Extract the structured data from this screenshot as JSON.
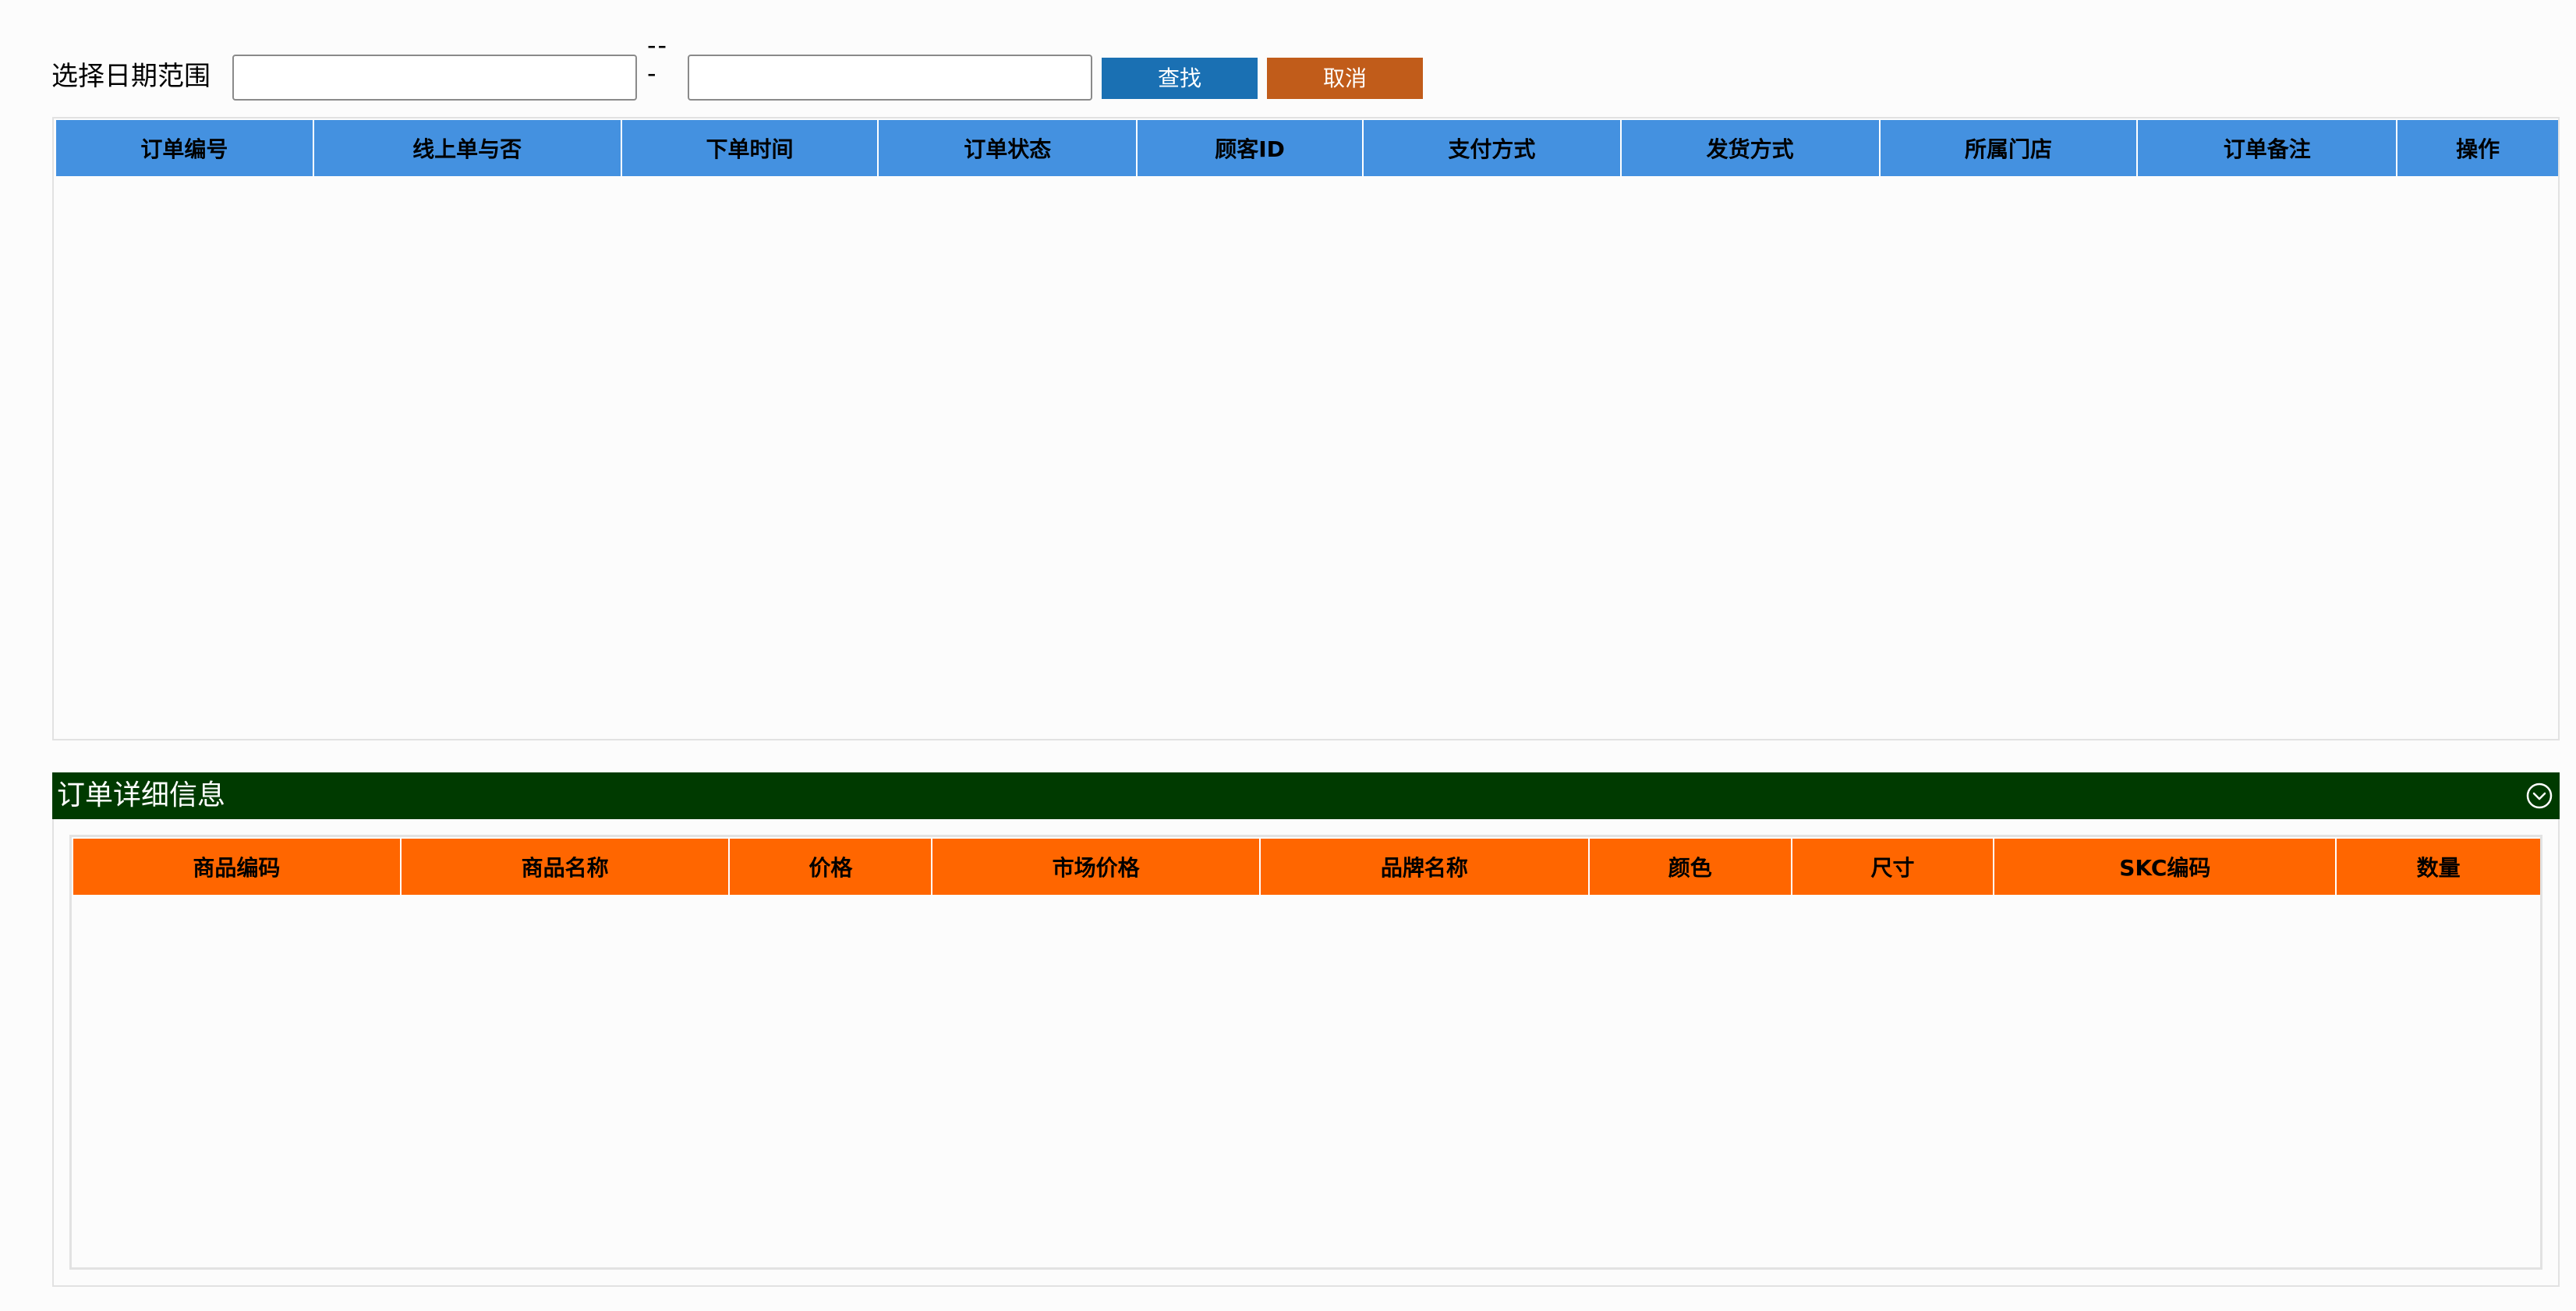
{
  "search": {
    "label": "选择日期范围",
    "start_value": "",
    "end_value": "",
    "separator": "--\n-",
    "search_button": "查找",
    "cancel_button": "取消"
  },
  "orders_grid": {
    "columns": [
      "订单编号",
      "线上单与否",
      "下单时间",
      "订单状态",
      "顾客ID",
      "支付方式",
      "发货方式",
      "所属门店",
      "订单备注",
      "操作"
    ],
    "rows": []
  },
  "detail_panel": {
    "title": "订单详细信息",
    "collapse_icon": "chevron-down-circle-icon",
    "columns": [
      "商品编码",
      "商品名称",
      "价格",
      "市场价格",
      "品牌名称",
      "颜色",
      "尺寸",
      "SKC编码",
      "数量"
    ],
    "rows": []
  },
  "colors": {
    "orders_header": "#4491e0",
    "detail_header": "#ff6600",
    "detail_title_bar": "#003a00",
    "search_button": "#1a70b3",
    "cancel_button": "#c15c1a"
  }
}
